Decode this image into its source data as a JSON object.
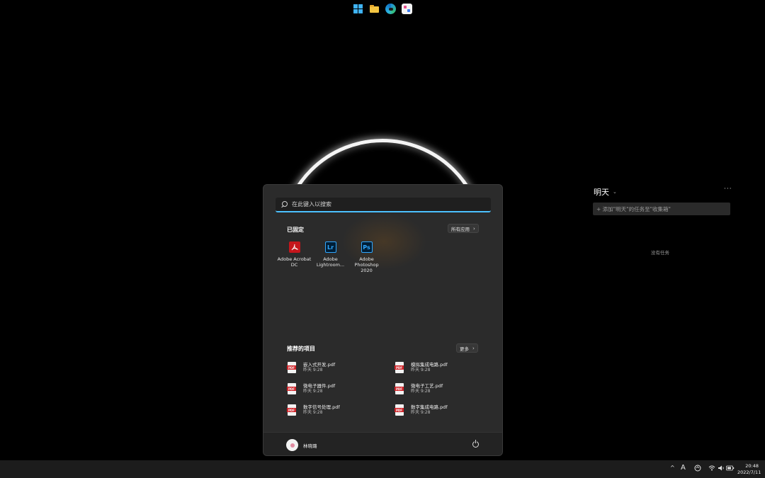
{
  "start_menu": {
    "search": {
      "placeholder": "在此键入以搜索"
    },
    "pinned": {
      "title": "已固定",
      "all_apps_label": "所有应用",
      "apps": [
        {
          "name": "Adobe Acrobat DC",
          "icon": "acrobat-icon",
          "icon_text": "",
          "color": "#c4161c"
        },
        {
          "name": "Adobe Lightroom...",
          "icon": "lightroom-icon",
          "icon_text": "Lr",
          "color": "#31a8ff"
        },
        {
          "name": "Adobe Photoshop 2020",
          "icon": "photoshop-icon",
          "icon_text": "Ps",
          "color": "#31a8ff"
        }
      ]
    },
    "recommended": {
      "title": "推荐的项目",
      "more_label": "更多",
      "items": [
        {
          "name": "嵌入式开发.pdf",
          "time": "昨天 9:28"
        },
        {
          "name": "模拟集成电路.pdf",
          "time": "昨天 9:28"
        },
        {
          "name": "微电子器件.pdf",
          "time": "昨天 9:28"
        },
        {
          "name": "微电子工艺.pdf",
          "time": "昨天 9:28"
        },
        {
          "name": "数字信号处理.pdf",
          "time": "昨天 9:28"
        },
        {
          "name": "数字集成电路.pdf",
          "time": "昨天 9:28"
        }
      ]
    },
    "user": {
      "name": "林晓璐"
    }
  },
  "todo_widget": {
    "title": "明天",
    "more": "···",
    "add_placeholder": "+ 添加\"明天\"的任务至\"收集箱\"",
    "empty_text": "没有任务"
  },
  "taskbar": {
    "apps": [
      "windows-start-icon",
      "file-explorer-icon",
      "edge-icon",
      "app-icon"
    ],
    "tray": {
      "chevron": "^",
      "ime": "A"
    },
    "clock": {
      "time": "20:48",
      "date": "2022/7/11"
    }
  },
  "colors": {
    "accent": "#4cc2ff",
    "menu_bg": "#2b2b2b",
    "pdf_red": "#d0262b"
  }
}
